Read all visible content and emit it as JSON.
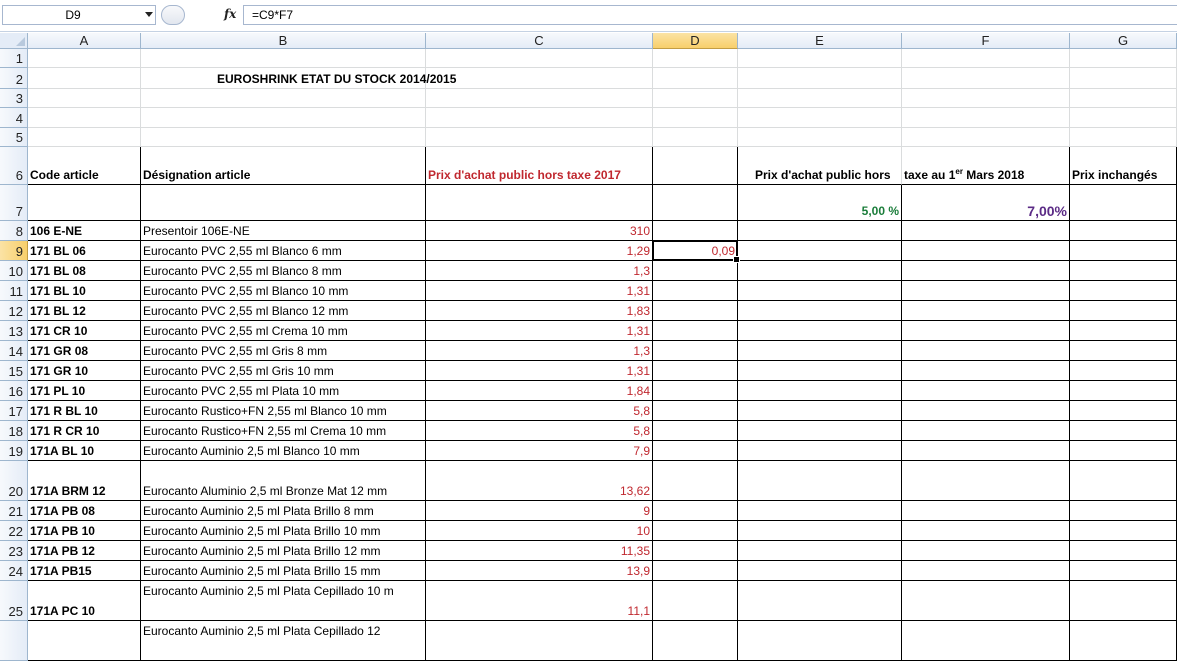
{
  "formula_bar": {
    "name_box": "D9",
    "fx_label": "fx",
    "formula": "=C9*F7"
  },
  "columns": [
    "A",
    "B",
    "C",
    "D",
    "E",
    "F",
    "G"
  ],
  "selected_column": "D",
  "selected_row": "9",
  "sheet": {
    "title": "EUROSHRINK ETAT DU STOCK 2014/2015",
    "headers": {
      "code": "Code article",
      "designation": "Désignation article",
      "price_2017": "Prix d'achat public hors taxe 2017",
      "price_2018_part1": "Prix d'achat public hors",
      "price_2018_part2_a": "taxe au 1",
      "price_2018_part2_sup": "er",
      "price_2018_part2_b": " Mars 2018",
      "unchanged": "Prix inchangés"
    },
    "rate_e7": "5,00 %",
    "rate_f7": "7,00%",
    "d9_value": "0,09",
    "rows": [
      {
        "row": "8",
        "code": "106 E-NE",
        "designation": "Presentoir 106E-NE",
        "price": "310"
      },
      {
        "row": "9",
        "code": "171 BL 06",
        "designation": "Eurocanto PVC 2,55 ml Blanco 6 mm",
        "price": "1,29"
      },
      {
        "row": "10",
        "code": "171 BL 08",
        "designation": "Eurocanto PVC 2,55 ml Blanco 8 mm",
        "price": "1,3"
      },
      {
        "row": "11",
        "code": "171 BL 10",
        "designation": "Eurocanto PVC 2,55 ml Blanco 10 mm",
        "price": "1,31"
      },
      {
        "row": "12",
        "code": "171 BL 12",
        "designation": "Eurocanto PVC 2,55 ml Blanco 12 mm",
        "price": "1,83"
      },
      {
        "row": "13",
        "code": "171 CR 10",
        "designation": "Eurocanto PVC 2,55 ml Crema 10 mm",
        "price": "1,31"
      },
      {
        "row": "14",
        "code": "171 GR 08",
        "designation": "Eurocanto PVC 2,55 ml Gris 8 mm",
        "price": "1,3"
      },
      {
        "row": "15",
        "code": "171 GR 10",
        "designation": "Eurocanto PVC 2,55 ml Gris 10 mm",
        "price": "1,31"
      },
      {
        "row": "16",
        "code": "171 PL 10",
        "designation": "Eurocanto PVC 2,55 ml Plata 10 mm",
        "price": "1,84"
      },
      {
        "row": "17",
        "code": "171 R BL 10",
        "designation": "Eurocanto Rustico+FN 2,55 ml Blanco 10 mm",
        "price": "5,8"
      },
      {
        "row": "18",
        "code": "171 R CR 10",
        "designation": "Eurocanto Rustico+FN 2,55 ml Crema 10 mm",
        "price": "5,8"
      },
      {
        "row": "19",
        "code": "171A BL 10",
        "designation": "Eurocanto Auminio 2,5 ml Blanco 10 mm",
        "price": "7,9"
      },
      {
        "row": "20",
        "code": "171A BRM 12",
        "designation": "Eurocanto Aluminio 2,5 ml Bronze Mat 12 mm",
        "price": "13,62"
      },
      {
        "row": "21",
        "code": "171A PB 08",
        "designation": "Eurocanto Auminio 2,5 ml Plata Brillo 8 mm",
        "price": "9"
      },
      {
        "row": "22",
        "code": "171A PB 10",
        "designation": "Eurocanto Auminio 2,5 ml Plata Brillo 10 mm",
        "price": "10"
      },
      {
        "row": "23",
        "code": "171A PB 12",
        "designation": "Eurocanto Auminio 2,5 ml Plata Brillo 12 mm",
        "price": "11,35"
      },
      {
        "row": "24",
        "code": "171A PB15",
        "designation": "Eurocanto Auminio 2,5 ml Plata Brillo 15 mm",
        "price": "13,9"
      },
      {
        "row": "25",
        "code": "171A PC 10",
        "designation": "Eurocanto Auminio 2,5 ml Plata Cepillado 10 m",
        "price": "11,1"
      },
      {
        "row": "",
        "code": "",
        "designation": "Eurocanto Auminio 2,5 ml Plata Cepillado 12",
        "price": ""
      }
    ]
  },
  "colors": {
    "price_text": "#c0282f",
    "rate_e7": "#1a7d3a",
    "rate_f7": "#5b2b86",
    "selected_header": "#f8cf6b"
  }
}
